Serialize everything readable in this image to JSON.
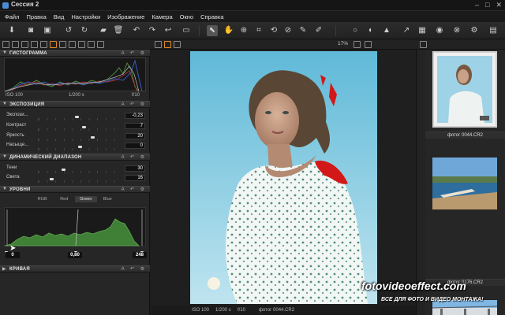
{
  "window": {
    "title": "Сессия 2",
    "controls": [
      "–",
      "□",
      "✕"
    ]
  },
  "menu": [
    "Файл",
    "Правка",
    "Вид",
    "Настройки",
    "Изображение",
    "Камера",
    "Окно",
    "Справка"
  ],
  "toolbar": {
    "icons": [
      "import-icon",
      "camera-icon",
      "browser-icon",
      "rotate-left-icon",
      "rotate-right-icon",
      "folder-icon",
      "trash-icon",
      "undo-icon",
      "redo-icon",
      "history-icon",
      "compare-icon",
      "select-icon",
      "pan-icon",
      "zoom-icon",
      "crop-icon",
      "rotate-icon",
      "straighten-icon",
      "color-picker-icon",
      "brush-icon",
      "search-icon",
      "exposure-warning-icon",
      "warning-icon",
      "arrow-icon",
      "grid-icon",
      "target-icon",
      "reset-icon",
      "settings-icon",
      "more-icon"
    ]
  },
  "subtoolbar": {
    "zoom": "17%"
  },
  "panels": {
    "histogram": {
      "title": "ГИСТОГРАММА",
      "iso": "ISO 100",
      "shutter": "1/200 s",
      "aperture": "f/10"
    },
    "exposure": {
      "title": "ЭКСПОЗИЦИЯ",
      "controls_glyphs": "A ↶ ⚙",
      "rows": [
        {
          "label": "Экспози...",
          "value": "-0,23",
          "level": 0.46
        },
        {
          "label": "Контраст",
          "value": "7",
          "level": 0.55
        },
        {
          "label": "Яркость",
          "value": "20",
          "level": 0.65
        },
        {
          "label": "Насыще...",
          "value": "0",
          "level": 0.5
        }
      ]
    },
    "dynamic_range": {
      "title": "ДИНАМИЧЕСКИЙ ДИАПАЗОН",
      "rows": [
        {
          "label": "Тени",
          "value": "30",
          "level": 0.3
        },
        {
          "label": "Света",
          "value": "16",
          "level": 0.16
        }
      ]
    },
    "levels": {
      "title": "УРОВНИ",
      "tabs": [
        "RGB",
        "Red",
        "Green",
        "Blue"
      ],
      "active_tab": "Green",
      "black": "0",
      "mid": "0,80",
      "white": "248"
    },
    "curve": {
      "title": "КРИВАЯ"
    }
  },
  "status": {
    "iso": "ISO 100",
    "shutter": "1/200 s",
    "aperture": "f/10",
    "filename": "фотог 0044.CR2"
  },
  "thumbnails": [
    {
      "caption": "фотог 0044.CR2",
      "selected": true
    },
    {
      "caption": "фотог 0176.CR2",
      "selected": false
    },
    {
      "caption": "",
      "selected": false
    }
  ],
  "watermark": {
    "line1": "fotovideoeffect.com",
    "line2": "ВСЕ ДЛЯ ФОТО И ВИДЕО МОНТАЖА!"
  }
}
